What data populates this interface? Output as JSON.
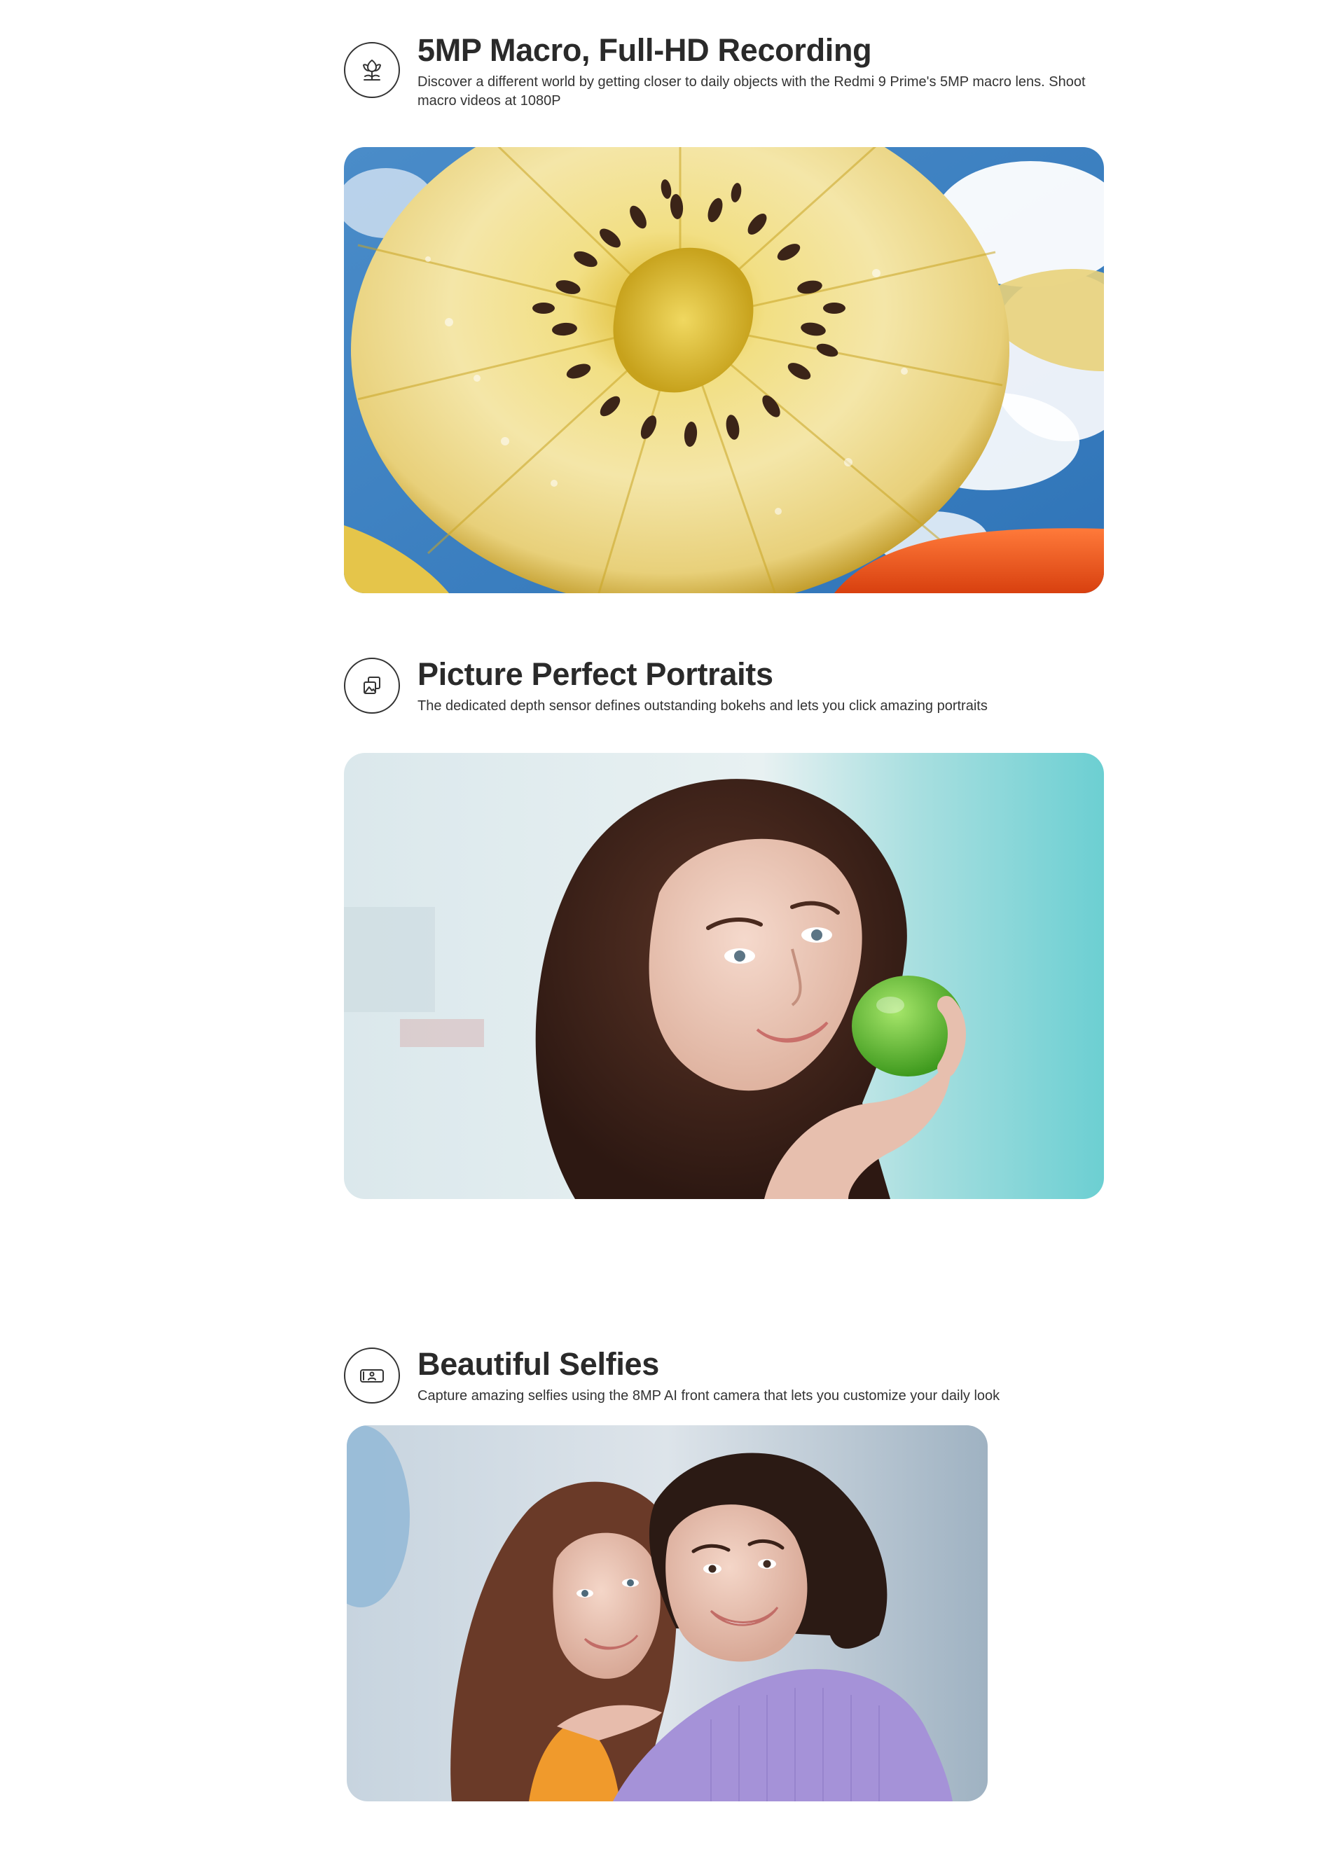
{
  "features": [
    {
      "icon": "flower-icon",
      "title": "5MP Macro, Full-HD Recording",
      "description": "Discover a different world by getting closer to daily objects with the Redmi 9 Prime's 5MP macro lens. Shoot macro videos at 1080P",
      "image": "kiwi-macro-photo"
    },
    {
      "icon": "portrait-layers-icon",
      "title": "Picture Perfect Portraits",
      "description": "The dedicated depth sensor defines outstanding bokehs and lets you click amazing portraits",
      "image": "portrait-woman-lime-photo"
    },
    {
      "icon": "selfie-camera-icon",
      "title": "Beautiful Selfies",
      "description": "Capture amazing selfies using the 8MP AI front camera that lets you customize your daily look",
      "image": "two-women-selfie-photo"
    }
  ],
  "colors": {
    "text": "#2a2a2a",
    "icon_stroke": "#333333",
    "background": "#ffffff"
  }
}
